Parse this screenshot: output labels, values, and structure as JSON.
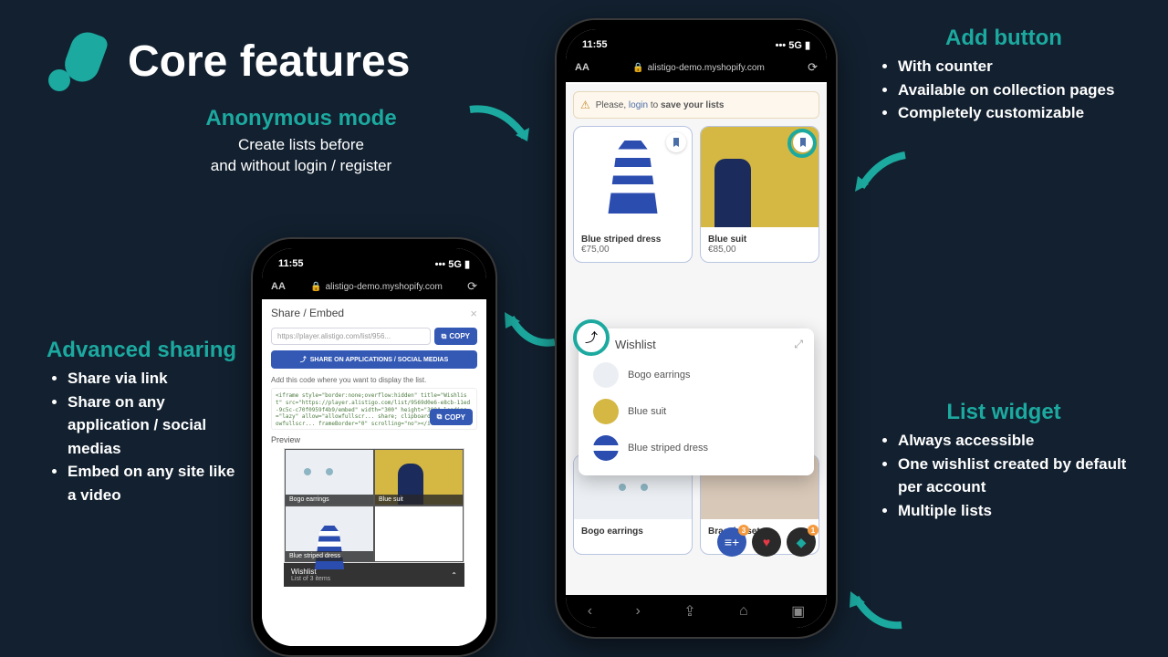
{
  "title": "Core features",
  "anonymous": {
    "title": "Anonymous mode",
    "sub1": "Create lists before",
    "sub2": "and without login / register"
  },
  "add_button": {
    "title": "Add button",
    "items": [
      "With counter",
      "Available on collection pages",
      "Completely customizable"
    ]
  },
  "list_widget": {
    "title": "List widget",
    "items": [
      "Always accessible",
      "One wishlist created by default per account",
      "Multiple lists"
    ]
  },
  "advanced_sharing": {
    "title": "Advanced sharing",
    "items": [
      "Share via link",
      "Share on any application / social medias",
      "Embed on any site like a video"
    ]
  },
  "phone": {
    "time": "11:55",
    "signal": "5G",
    "url": "alistigo-demo.myshopify.com",
    "aa": "AA",
    "alert_prefix": "Please, ",
    "alert_login": "login",
    "alert_mid": " to ",
    "alert_save": "save your lists",
    "products": {
      "p1": {
        "title": "Blue striped dress",
        "price": "€75,00"
      },
      "p2": {
        "title": "Blue suit",
        "price": "€85,00"
      },
      "p3": {
        "title": "Bogo earrings"
      },
      "p4": {
        "title": "Bracelet set"
      }
    },
    "wishlist": {
      "title": "Wishlist",
      "items": [
        "Bogo earrings",
        "Blue suit",
        "Blue striped dress"
      ]
    },
    "fab_badge": "1"
  },
  "share_panel": {
    "title": "Share / Embed",
    "link_placeholder": "https://player.alistigo.com/list/956...",
    "copy": "COPY",
    "share_social": "SHARE ON APPLICATIONS / SOCIAL MEDIAS",
    "embed_desc": "Add this code where you want to display the list.",
    "code_preview": "<iframe style=\"border:none;overflow:hidden\" title=\"Wishlist\" src=\"https://player.alistigo.com/list/9569d0e6-e8cb-11ed-9c5c-c70f0959f4b9/embed\" width=\"300\" height=\"300\" loading=\"lazy\" allow=\"allowfullscr... share; clipboard-write;\" allowfullscr... frameBorder=\"0\" scrolling=\"no\"></ifram...",
    "preview_label": "Preview",
    "preview": {
      "p1": "Bogo earrings",
      "p2": "Blue suit",
      "p3": "Blue striped dress",
      "footer_title": "Wishlist",
      "footer_sub": "List of 3 items"
    }
  }
}
